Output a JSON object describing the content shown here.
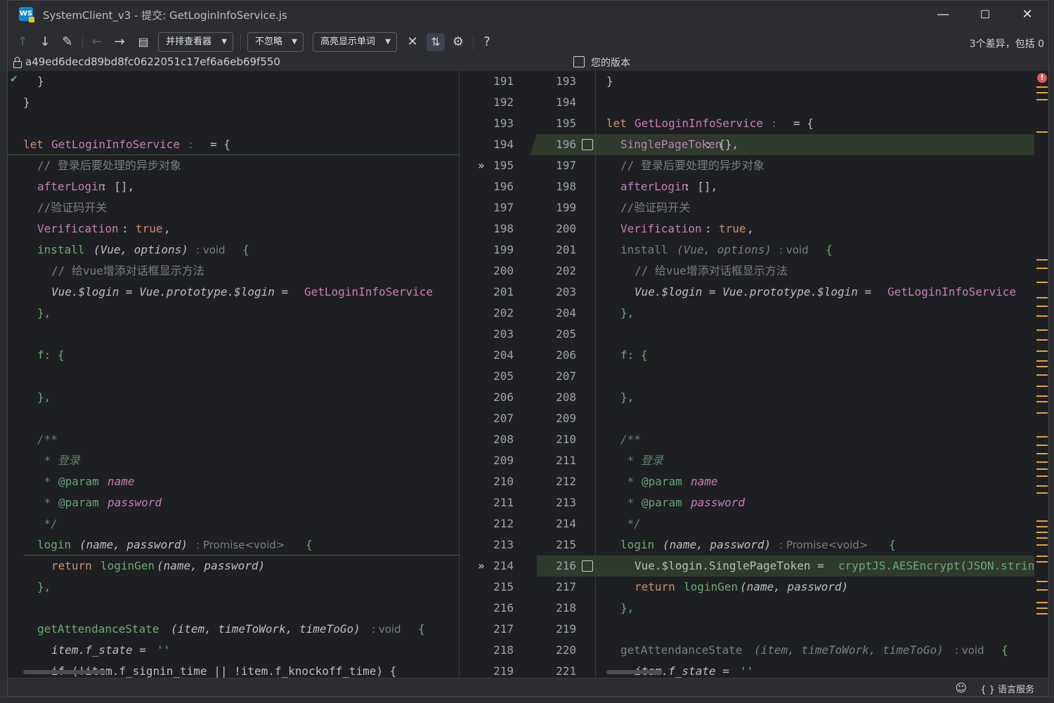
{
  "window": {
    "title": "SystemClient_v3 - 提交: GetLoginInfoService.js",
    "app_logo": "WS",
    "controls": {
      "minimize": "—",
      "maximize": "☐",
      "close": "✕"
    }
  },
  "toolbar": {
    "viewer_label": "并排查看器",
    "ignore_label": "不忽略",
    "highlight_label": "高亮显示单词",
    "diff_summary": "3个差异，包括 0",
    "icons": [
      "prev-diff-icon",
      "next-diff-icon",
      "edit-icon",
      "back-icon",
      "forward-icon",
      "file-icon",
      "collapse-icon",
      "sync-scroll-icon",
      "settings-icon",
      "help-icon"
    ],
    "help_glyph": "?"
  },
  "header": {
    "commit_hash": "a49ed6decd89bd8fc0622051c17ef6a6eb69f550",
    "your_version_label": "您的版本"
  },
  "left_numbers": [
    "191",
    "192",
    "193",
    "194",
    "195",
    "196",
    "197",
    "198",
    "199",
    "200",
    "201",
    "202",
    "203",
    "204",
    "205",
    "206",
    "207",
    "208",
    "209",
    "210",
    "211",
    "212",
    "213",
    "214",
    "215",
    "216",
    "217",
    "218",
    "219"
  ],
  "right_numbers": [
    "193",
    "194",
    "195",
    "196",
    "197",
    "198",
    "199",
    "200",
    "201",
    "202",
    "203",
    "204",
    "205",
    "206",
    "207",
    "208",
    "209",
    "210",
    "211",
    "212",
    "213",
    "214",
    "215",
    "216",
    "217",
    "218",
    "219",
    "220",
    "221"
  ],
  "gutter": {
    "chevron": "»"
  },
  "code": {
    "brace_close": "}",
    "let_kw": "let",
    "svc_name": "GetLoginInfoService",
    "colon": ":",
    "eq_brace": "= {",
    "single_page_token": "SinglePageToken",
    "single_page_token_val": ": {},",
    "comment_async": "// 登录后要处理的异步对象",
    "after_login": "afterLogin",
    "after_login_val": ": [],",
    "comment_captcha": "//验证码开关",
    "verification": "Verification",
    "true_kw": "true",
    "comma": ",",
    "install": "install",
    "install_params": "(Vue, options)",
    "hint_void": ": void",
    "open_brace": "{",
    "comment_dialog": "// 给vue增添对话框显示方法",
    "vue_login": "Vue.$login = Vue.prototype.$login = ",
    "close_brace_comma": "},",
    "f_open": "f: {",
    "doc_open": "/**",
    "doc_login": " * 登录",
    "doc_star": " * ",
    "param_tag": "@param",
    "param_name": "name",
    "param_password": "password",
    "doc_close": " */",
    "login_fn": "login",
    "login_params": "(name, password)",
    "hint_promise": ": Promise<void>",
    "return_kw": "return",
    "login_gen": "loginGen",
    "login_gen_args": "(name, password)",
    "token_line": "Vue.$login.SinglePageToken = ",
    "crypto_call": "cryptJS.AESEncrypt(JSON.stringi",
    "attendance_fn": "getAttendanceState",
    "attendance_params": "(item, timeToWork, timeToGo)",
    "item_state": "item.f_state = ",
    "empty_str": "''",
    "if_line": "if (!item.f_signin_time || !item.f_knockoff_time) {"
  },
  "status": {
    "language_service": "{ } 语言服务"
  },
  "colors": {
    "background": "#1e1f22",
    "panel": "#2b2d30",
    "keyword": "#cf8e6d",
    "function": "#56a8f5",
    "property": "#c77dbb",
    "comment": "#7a7e85",
    "added_line": "#2e3a2c",
    "marker": "#e5a43a",
    "error": "#db5c5c"
  }
}
